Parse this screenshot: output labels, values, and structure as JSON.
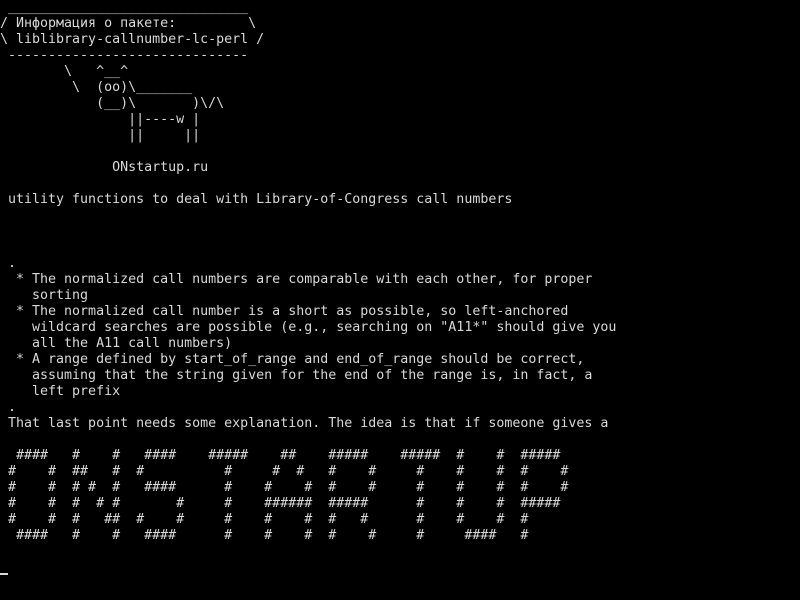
{
  "terminal": {
    "fg_color": "#d8d8d8",
    "bg_color": "#000000",
    "lines": [
      " ______________________________",
      "/ Информация о пакете:         \\",
      "\\ liblibrary-callnumber-lc-perl /",
      " ------------------------------",
      "        \\   ^__^",
      "         \\  (oo)\\_______",
      "            (__)\\       )\\/\\",
      "                ||----w |",
      "                ||     ||",
      "",
      "              ONstartup.ru",
      "",
      " utility functions to deal with Library-of-Congress call numbers",
      "",
      "",
      "",
      " .",
      "  * The normalized call numbers are comparable with each other, for proper",
      "    sorting",
      "  * The normalized call number is a short as possible, so left-anchored",
      "    wildcard searches are possible (e.g., searching on \"A11*\" should give you",
      "    all the A11 call numbers)",
      "  * A range defined by start_of_range and end_of_range should be correct,",
      "    assuming that the string given for the end of the range is, in fact, a",
      "    left prefix",
      " .",
      " That last point needs some explanation. The idea is that if someone gives a",
      "",
      "  ####   #    #   ####    #####    ##    #####    #####  #    #  #####",
      " #    #  ##   #  #          #     #  #   #    #     #    #    #  #    #",
      " #    #  # #  #   ####      #    #    #  #    #     #    #    #  #    #",
      " #    #  #  # #       #     #    ######  #####      #    #    #  #####",
      " #    #  #   ##  #    #     #    #    #  #   #      #    #    #  #",
      "  ####   #    #   ####      #    #    #  #    #     #     ####   #"
    ]
  }
}
